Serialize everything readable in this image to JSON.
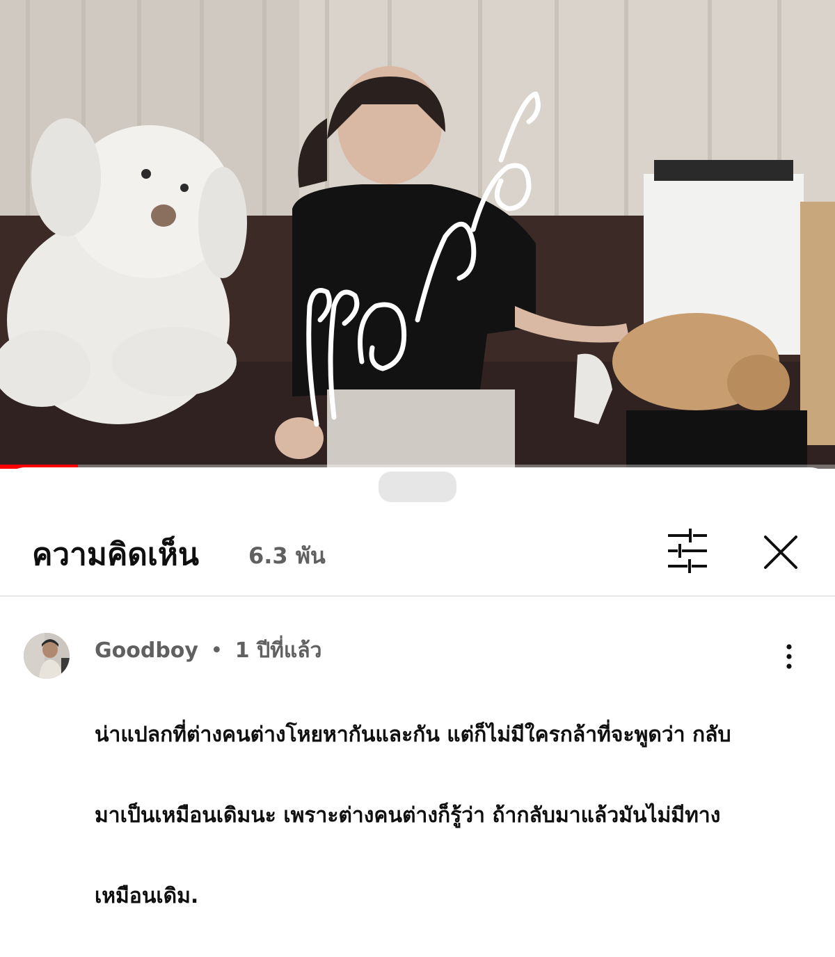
{
  "video": {
    "overlay_title": "แอบหวัง",
    "progress_fraction": 0.093,
    "progress_color": "#ff0000"
  },
  "comments_panel": {
    "title": "ความคิดเห็น",
    "count": "6.3 พัน",
    "filter_icon": "tune-sliders-icon",
    "close_icon": "close-icon"
  },
  "comments": [
    {
      "author": "Goodboy",
      "separator": "•",
      "time": "1 ปีที่แล้ว",
      "text_lines": [
        "น่าแปลกที่ต่างคนต่างโหยหากันและกัน แต่ก็ไม่มีใครกล้าที่จะพูดว่า กลับ",
        "มาเป็นเหมือนเดิมนะ เพราะต่างคนต่างก็รู้ว่า ถ้ากลับมาแล้วมันไม่มีทาง",
        "เหมือนเดิม."
      ],
      "menu_icon": "more-vertical-icon"
    }
  ]
}
